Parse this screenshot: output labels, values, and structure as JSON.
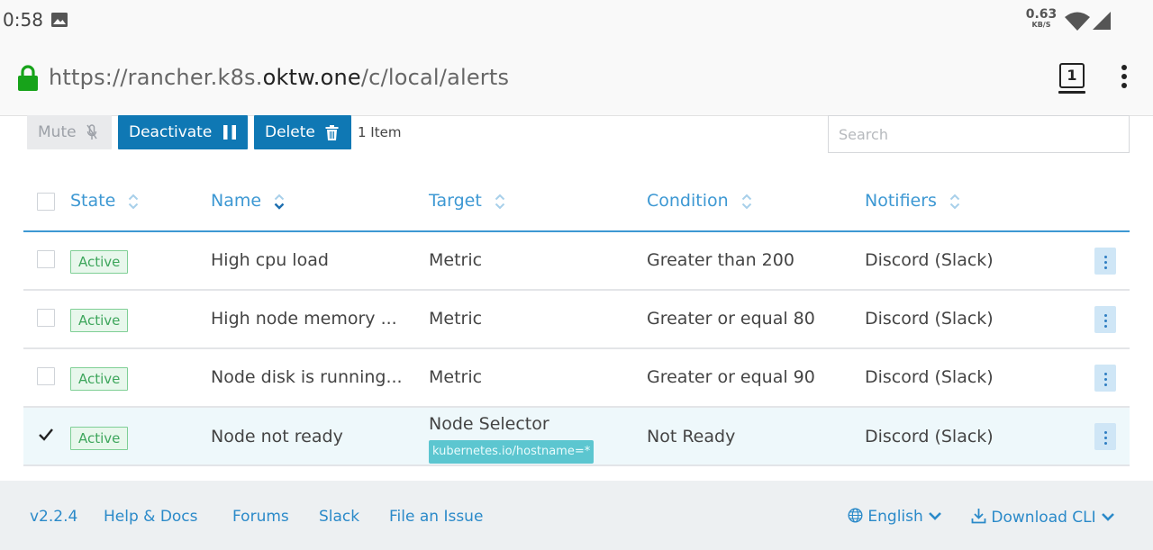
{
  "status_bar": {
    "time": "0:58",
    "net_speed": "0.63",
    "net_speed_unit": "KB/S"
  },
  "browser": {
    "url_prefix": "https://rancher.k8s.",
    "url_domain": "oktw.one",
    "url_path": "/c/local/alerts",
    "tab_count": "1"
  },
  "toolbar": {
    "mute_label": "Mute",
    "deactivate_label": "Deactivate",
    "delete_label": "Delete",
    "item_count": "1 Item",
    "search_placeholder": "Search"
  },
  "table": {
    "columns": [
      "State",
      "Name",
      "Target",
      "Condition",
      "Notifiers"
    ],
    "rows": [
      {
        "state": "Active",
        "name": "High cpu load",
        "target": "Metric",
        "target_tag": "",
        "condition": "Greater than 200",
        "notifiers": "Discord (Slack)",
        "checked": false
      },
      {
        "state": "Active",
        "name": "High node memory ...",
        "target": "Metric",
        "target_tag": "",
        "condition": "Greater or equal 80",
        "notifiers": "Discord (Slack)",
        "checked": false
      },
      {
        "state": "Active",
        "name": "Node disk is running...",
        "target": "Metric",
        "target_tag": "",
        "condition": "Greater or equal 90",
        "notifiers": "Discord (Slack)",
        "checked": false
      },
      {
        "state": "Active",
        "name": "Node not ready",
        "target": "Node Selector",
        "target_tag": "kubernetes.io/hostname=*",
        "condition": "Not Ready",
        "notifiers": "Discord (Slack)",
        "checked": true
      }
    ]
  },
  "footer": {
    "version": "v2.2.4",
    "help_docs": "Help & Docs",
    "forums": "Forums",
    "slack": "Slack",
    "file_issue": "File an Issue",
    "language": "English",
    "download_cli": "Download CLI"
  },
  "colors": {
    "primary": "#0f78b4",
    "header_text": "#3d98d3",
    "active_green": "#3ea65c",
    "link": "#2b8ac9"
  }
}
